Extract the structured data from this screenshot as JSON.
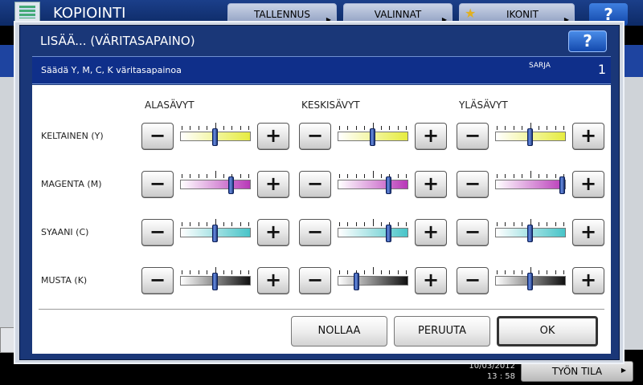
{
  "background": {
    "app_title": "KOPIOINTI",
    "tabs": [
      {
        "label": "TALLENNUS",
        "icon": "chevron-right-icon"
      },
      {
        "label": "VALINNAT",
        "icon": "chevron-right-icon"
      },
      {
        "label": "IKONIT",
        "icon": "star-icon"
      }
    ],
    "help_label": "?",
    "date": "10/03/2012",
    "time": "13 : 58",
    "status_button": "TYÖN TILA"
  },
  "dialog": {
    "title": "LISÄÄ... (VÄRITASAPAINO)",
    "help_label": "?",
    "instruction": "Säädä Y, M, C, K väritasapainoa",
    "sarja_label": "SARJA",
    "copy_count": "1",
    "columns": [
      "ALASÄVYT",
      "KESKISÄVYT",
      "YLÄSÄVYT"
    ],
    "minus_label": "−",
    "plus_label": "+",
    "rows": [
      {
        "label": "KELTAINEN (Y)",
        "color": "#e6ec40",
        "levels": [
          5,
          5,
          5
        ]
      },
      {
        "label": "MAGENTA (M)",
        "color": "#b838b8",
        "levels": [
          7,
          7,
          9
        ]
      },
      {
        "label": "SYAANI (C)",
        "color": "#48c4c8",
        "levels": [
          5,
          7,
          5
        ]
      },
      {
        "label": "MUSTA (K)",
        "color": "#111111",
        "levels": [
          5,
          3,
          5
        ]
      }
    ],
    "slider_steps": 9,
    "buttons": {
      "reset": "NOLLAA",
      "cancel": "PERUUTA",
      "ok": "OK"
    }
  }
}
